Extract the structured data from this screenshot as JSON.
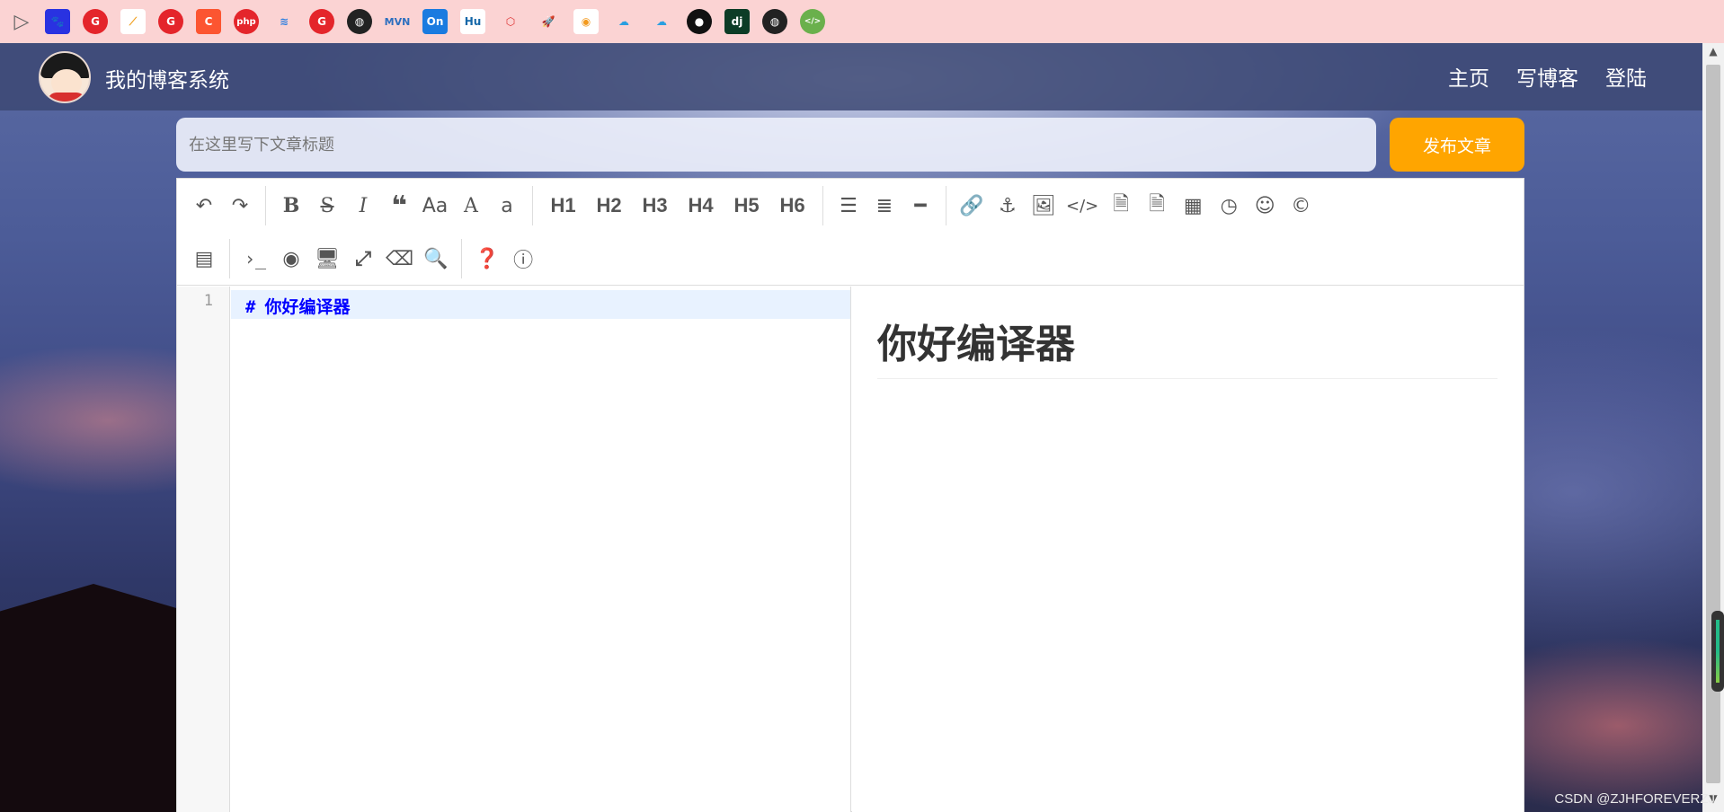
{
  "bookmarks": [
    {
      "icon": "sidebar-toggle-icon"
    },
    {
      "icon": "baidu-icon",
      "color": "#2932e1"
    },
    {
      "icon": "g-red-icon",
      "color": "#e4252b"
    },
    {
      "icon": "slash-icon",
      "color": "#f0a020"
    },
    {
      "icon": "g-red-icon",
      "color": "#e4252b"
    },
    {
      "icon": "csdn-icon",
      "color": "#fc5531"
    },
    {
      "icon": "php-icon",
      "color": "#e4252b"
    },
    {
      "icon": "stack-icon",
      "color": "#2d7fe0"
    },
    {
      "icon": "g-red-icon",
      "color": "#e4252b"
    },
    {
      "icon": "globe-icon",
      "color": "#222222"
    },
    {
      "icon": "mvn-icon",
      "text": "MVN",
      "color": "#2d6fbf"
    },
    {
      "icon": "on-icon",
      "text": "On",
      "color": "#1a7be0"
    },
    {
      "icon": "hu-icon",
      "text": "Hu",
      "color": "#1467a8"
    },
    {
      "icon": "cube-icon",
      "color": "#d33"
    },
    {
      "icon": "rocket-icon",
      "color": "#3a8ee6"
    },
    {
      "icon": "gitee-icon",
      "color": "#f39a1e"
    },
    {
      "icon": "cloud-icon",
      "color": "#2a9fe0"
    },
    {
      "icon": "cloud-icon",
      "color": "#2a9fe0"
    },
    {
      "icon": "github-icon",
      "color": "#111111"
    },
    {
      "icon": "django-icon",
      "text": "dj",
      "color": "#0c3c26"
    },
    {
      "icon": "globe-icon",
      "color": "#222222"
    },
    {
      "icon": "code-badge-icon",
      "color": "#6ab04c"
    }
  ],
  "nav": {
    "site_title": "我的博客系统",
    "links": [
      "主页",
      "写博客",
      "登陆"
    ]
  },
  "title_row": {
    "placeholder": "在这里写下文章标题",
    "publish_label": "发布文章"
  },
  "toolbar": {
    "row1": [
      "↶",
      "↷",
      "|",
      "B",
      "S",
      "I",
      "❝",
      "Aa",
      "A",
      "a",
      "|",
      "H1",
      "H2",
      "H3",
      "H4",
      "H5",
      "H6",
      "|",
      "☰",
      "≡",
      "—",
      "|",
      "🔗",
      "⚓",
      "▣",
      "</>",
      "◰",
      "◰",
      "▦",
      "◷",
      "☺",
      "©"
    ],
    "row2": [
      "▤",
      "|",
      "›_",
      "◎",
      "▭",
      "⤢",
      "⌫",
      "⚲",
      "|",
      "?",
      "i"
    ]
  },
  "editor": {
    "line_number": "1",
    "code_hash": "#",
    "code_text": "你好编译器"
  },
  "preview": {
    "heading": "你好编译器"
  },
  "watermark": "CSDN @ZJHFOREVERZJ",
  "colors": {
    "accent": "#ffa500",
    "markdown_heading": "#0000ff",
    "bookmarks_bg": "#fbd3d3"
  }
}
